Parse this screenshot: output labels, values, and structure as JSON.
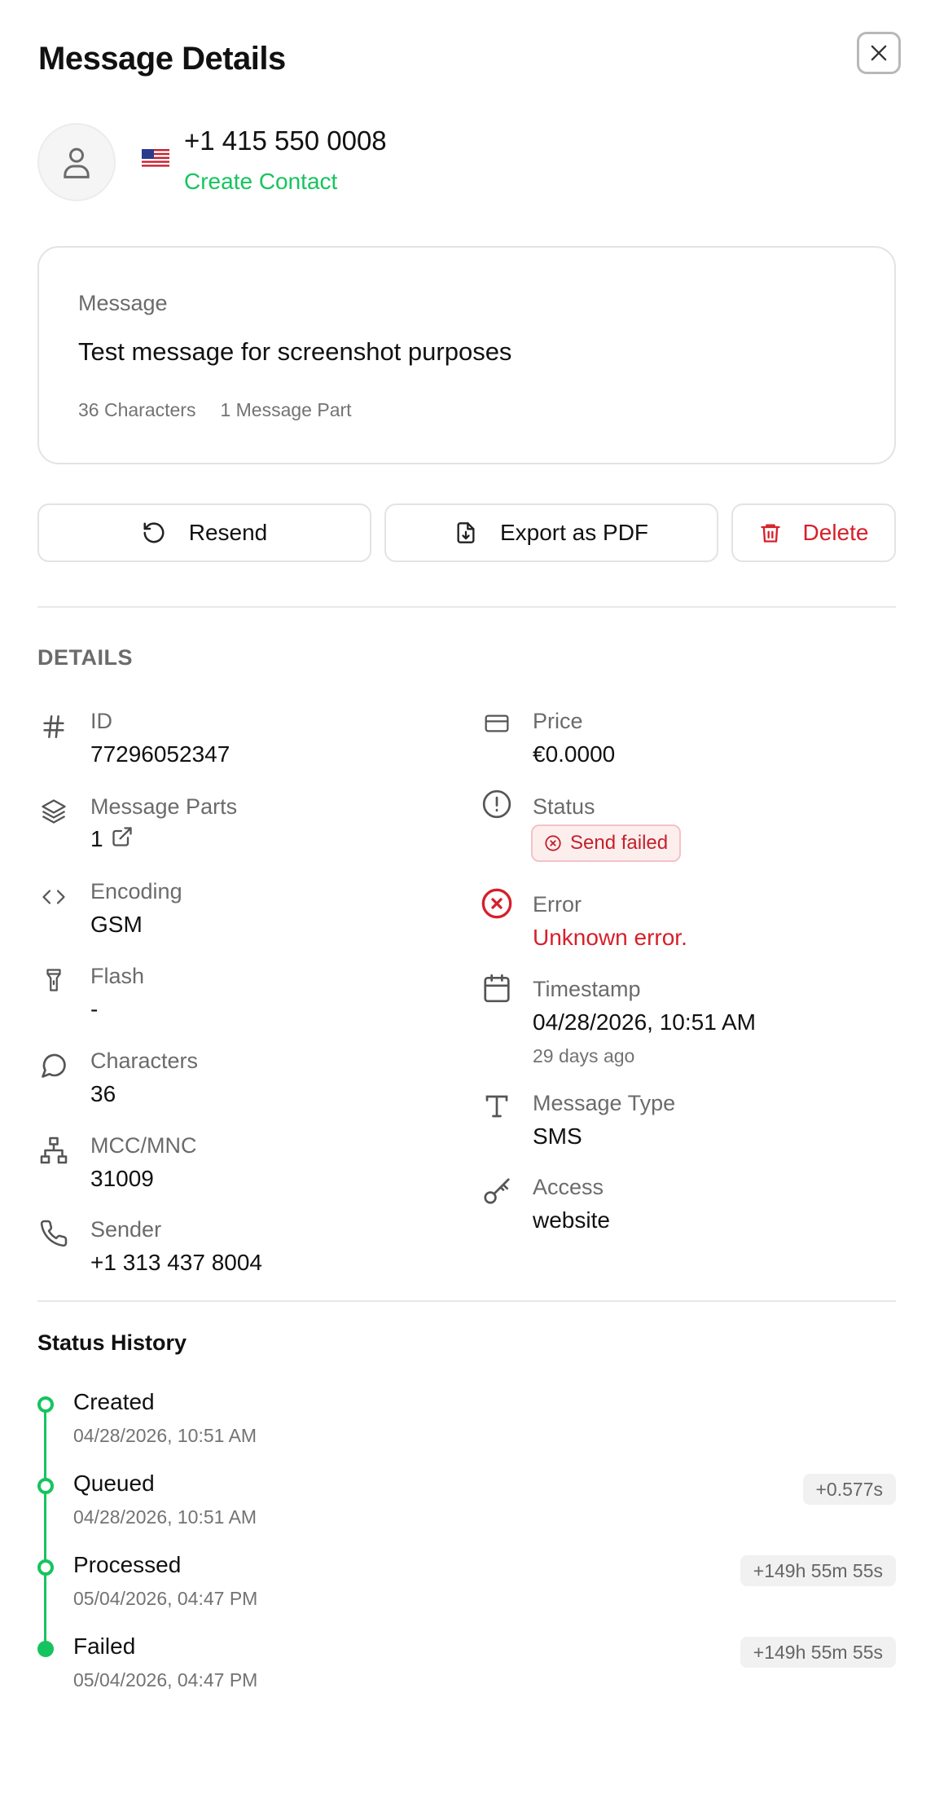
{
  "header": {
    "title": "Message Details"
  },
  "contact": {
    "flag": "🇺🇸",
    "phone": "+1 415 550 0008",
    "create_label": "Create Contact"
  },
  "message": {
    "label": "Message",
    "text": "Test message for screenshot purposes",
    "characters": "36 Characters",
    "parts": "1 Message Part"
  },
  "actions": {
    "resend": "Resend",
    "export": "Export as PDF",
    "delete": "Delete"
  },
  "details": {
    "section_title": "DETAILS",
    "id": {
      "label": "ID",
      "value": "77296052347"
    },
    "message_parts": {
      "label": "Message Parts",
      "value": "1"
    },
    "encoding": {
      "label": "Encoding",
      "value": "GSM"
    },
    "flash": {
      "label": "Flash",
      "value": "-"
    },
    "characters": {
      "label": "Characters",
      "value": "36"
    },
    "mcc_mnc": {
      "label": "MCC/MNC",
      "value": "31009"
    },
    "sender": {
      "label": "Sender",
      "value": "+1 313 437 8004"
    },
    "price": {
      "label": "Price",
      "value": "€0.0000"
    },
    "status": {
      "label": "Status",
      "value": "Send failed"
    },
    "error": {
      "label": "Error",
      "value": "Unknown error."
    },
    "timestamp": {
      "label": "Timestamp",
      "value": "04/28/2026, 10:51 AM",
      "relative": "29 days ago"
    },
    "message_type": {
      "label": "Message Type",
      "value": "SMS"
    },
    "access": {
      "label": "Access",
      "value": "website"
    }
  },
  "history": {
    "title": "Status History",
    "items": [
      {
        "label": "Created",
        "time": "04/28/2026, 10:51 AM",
        "delta": ""
      },
      {
        "label": "Queued",
        "time": "04/28/2026, 10:51 AM",
        "delta": "+0.577s"
      },
      {
        "label": "Processed",
        "time": "05/04/2026, 04:47 PM",
        "delta": "+149h 55m 55s"
      },
      {
        "label": "Failed",
        "time": "05/04/2026, 04:47 PM",
        "delta": "+149h 55m 55s"
      }
    ]
  },
  "colors": {
    "accent": "#16c45f",
    "danger": "#d6202a",
    "muted": "#6b6b6b"
  }
}
